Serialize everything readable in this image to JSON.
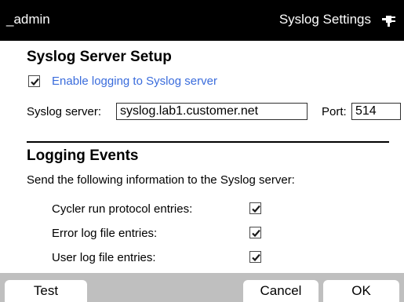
{
  "header": {
    "user": "_admin",
    "title": "Syslog Settings",
    "connection_icon": "plug-icon",
    "background": "#000000",
    "text_color": "#ffffff"
  },
  "server_setup": {
    "heading": "Syslog Server Setup",
    "enable_label": "Enable logging to Syslog server",
    "enable_checked": true,
    "enable_label_color": "#3a6cdc",
    "server_label": "Syslog server:",
    "server_value": "syslog.lab1.customer.net",
    "port_label": "Port:",
    "port_value": "514"
  },
  "logging_events": {
    "heading": "Logging Events",
    "description": "Send the following information to the Syslog server:",
    "items": [
      {
        "label": "Cycler run protocol entries:",
        "checked": true
      },
      {
        "label": "Error log file entries:",
        "checked": true
      },
      {
        "label": "User log file entries:",
        "checked": true
      }
    ]
  },
  "footer": {
    "test_label": "Test",
    "cancel_label": "Cancel",
    "ok_label": "OK",
    "bar_color": "#bfbfbf"
  }
}
